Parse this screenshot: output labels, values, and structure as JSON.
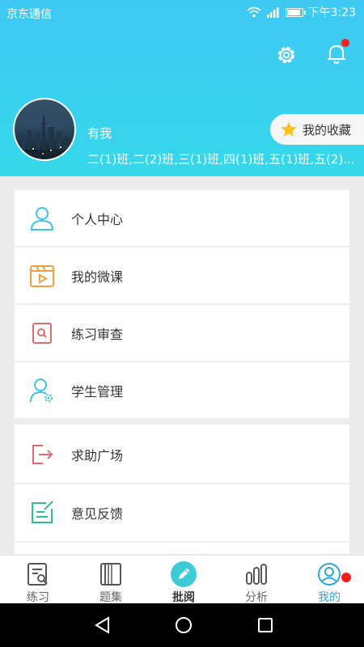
{
  "status_bar": {
    "carrier": "京东通信",
    "time": "下午3:23"
  },
  "profile": {
    "name": "有我",
    "classes": "二(1)班,二(2)班,三(1)班,四(1)班,五(1)班,五(2)...",
    "favorites_label": "我的收藏"
  },
  "menu_group1": [
    {
      "label": "个人中心",
      "icon": "user-icon"
    },
    {
      "label": "我的微课",
      "icon": "video-icon"
    },
    {
      "label": "练习审查",
      "icon": "search-doc-icon"
    },
    {
      "label": "学生管理",
      "icon": "user-gear-icon"
    }
  ],
  "menu_group2": [
    {
      "label": "求助广场",
      "icon": "exit-icon"
    },
    {
      "label": "意见反馈",
      "icon": "feedback-icon"
    }
  ],
  "tabs": [
    {
      "label": "练习",
      "icon": "practice-icon"
    },
    {
      "label": "题集",
      "icon": "book-icon"
    },
    {
      "label": "批阅",
      "icon": "pencil-icon"
    },
    {
      "label": "分析",
      "icon": "chart-icon"
    },
    {
      "label": "我的",
      "icon": "profile-icon",
      "active": true
    }
  ],
  "colors": {
    "accent": "#2aa8d8",
    "header": "#3ecbf2",
    "badge": "#ff1a1a"
  }
}
